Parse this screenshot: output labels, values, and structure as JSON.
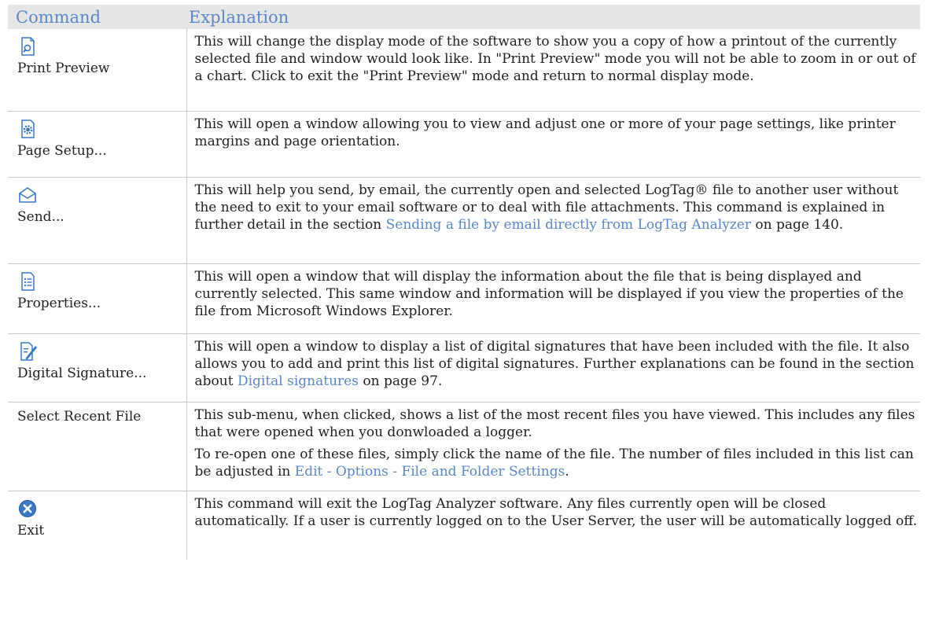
{
  "header": {
    "command": "Command",
    "explanation": "Explanation"
  },
  "rows": [
    {
      "command": "Print Preview",
      "icon": "print-preview-icon",
      "text": "This will change the display mode of the software to show you a copy of how a printout of the currently selected file and window would look like. In \"Print Preview\" mode you will not be able to zoom in or out of a chart. Click to exit the \"Print Preview\" mode and return to normal display mode."
    },
    {
      "command": "Page Setup...",
      "icon": "page-setup-icon",
      "text": "This will open a window allowing you to view and adjust one or more of your page settings, like printer margins and page orientation."
    },
    {
      "command": "Send...",
      "icon": "envelope-icon",
      "text_before": "This will help you send, by email, the currently open and selected LogTag® file to another user without the need to exit to your email software or to deal with file attachments. This command is explained in further detail in the section ",
      "link": "Sending a file by email directly from LogTag Analyzer",
      "text_after": " on page 140."
    },
    {
      "command": "Properties...",
      "icon": "properties-list-icon",
      "text": "This will open a window that will display the information about the file that is being displayed and currently selected. This same window and information will be displayed if you view the properties of the file from Microsoft Windows Explorer."
    },
    {
      "command": "Digital Signature...",
      "icon": "digital-signature-icon",
      "text_before": "This will open a window to display a list of digital signatures that have been included with the file. It also allows you to add and print this list of digital signatures. Further explanations can be found in the section about ",
      "link": "Digital signatures",
      "text_after": "  on page 97."
    },
    {
      "command": "Select Recent File",
      "text": "This sub-menu, when clicked, shows a list of the most recent files you have viewed. This includes any files that were opened when you donwloaded a logger.",
      "text2_before": "To re-open one of these files, simply click the name of the file. The number of files included in this list can be adjusted in ",
      "link": "Edit - Options - File and Folder Settings",
      "text2_after": "."
    },
    {
      "command": "Exit",
      "icon": "exit-icon",
      "text": "This command will exit the LogTag Analyzer software. Any files currently open will be closed automatically. If a user is currently logged on to the User Server, the user will be automatically logged off."
    }
  ],
  "colors": {
    "heading": "#5b87c9",
    "link": "#5b87c9",
    "header_bg": "#e6e6e6",
    "icon_blue": "#3a78c6"
  }
}
